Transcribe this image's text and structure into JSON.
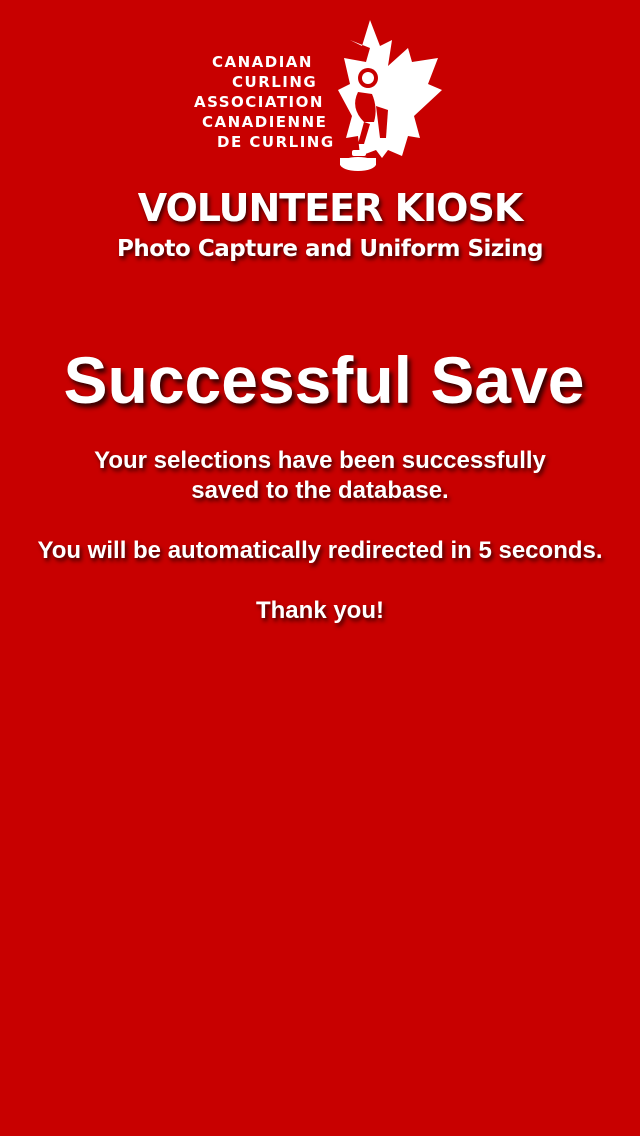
{
  "logo": {
    "lines": [
      "CANADIAN",
      "CURLING",
      "ASSOCIATION",
      "CANADIENNE",
      "DE CURLING"
    ],
    "icon": "maple-leaf-curler-icon"
  },
  "header": {
    "title": "VOLUNTEER KIOSK",
    "subtitle": "Photo Capture and Uniform Sizing"
  },
  "main": {
    "headline": "Successful Save",
    "message_line1": "Your selections have been successfully",
    "message_line2": "saved to the database.",
    "redirect_text": "You will be automatically redirected in 5 seconds.",
    "thanks": "Thank you!"
  },
  "colors": {
    "background": "#c80000",
    "text": "#ffffff"
  }
}
